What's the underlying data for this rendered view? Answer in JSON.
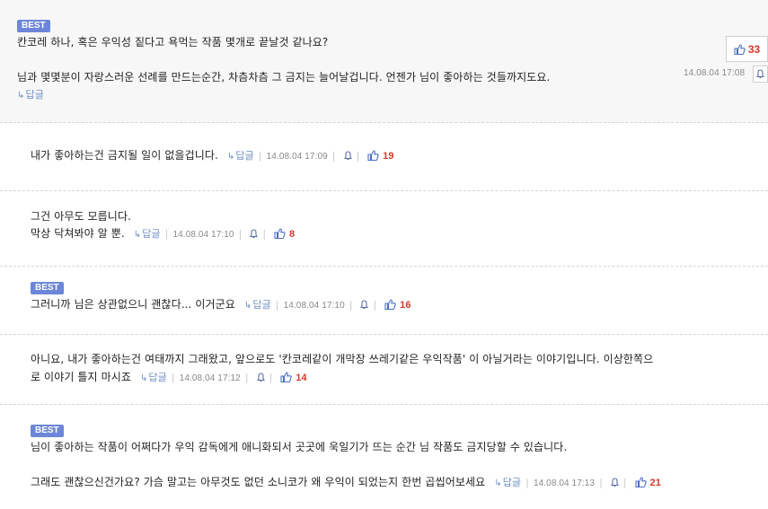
{
  "colors": {
    "badge": "#6d86d9",
    "like_count": "#d43a2c",
    "reply_link": "#6f8fc8",
    "date": "#888888"
  },
  "icons": {
    "reply": "reply-arrow-icon",
    "report": "bell-icon",
    "like": "thumbs-up-icon"
  },
  "comments": [
    {
      "badge": "BEST",
      "line1": "칸코레 하나, 혹은 우익성 짙다고 욕먹는 작품 몇개로 끝날것 같나요?",
      "line2": "님과 몇몇분이 자랑스러운 선례를 만드는순간, 차츰차츰 그 금지는 늘어날겁니다. 언젠가 님이 좋아하는 것들까지도요.",
      "reply": "답글",
      "date": "14.08.04 17:08",
      "likes": "33"
    },
    {
      "line1": "내가 좋아하는건 금지될 일이 없을겁니다.",
      "reply": "답글",
      "date": "14.08.04 17:09",
      "likes": "19"
    },
    {
      "line1": "그건 아무도 모릅니다.",
      "line2": "막상 닥쳐봐야 알 뿐.",
      "reply": "답글",
      "date": "14.08.04 17:10",
      "likes": "8"
    },
    {
      "badge": "BEST",
      "line1": "그러니까 님은 상관없으니 괜찮다... 이거군요",
      "reply": "답글",
      "date": "14.08.04 17:10",
      "likes": "16"
    },
    {
      "line1": "아니요, 내가 좋아하는건 여태까지 그래왔고, 앞으로도 '칸코레같이 개막장 쓰레기같은 우익작품' 이 아닐거라는 이야기입니다. 이상한쪽으",
      "line2": "로 이야기 틀지 마시죠",
      "reply": "답글",
      "date": "14.08.04 17:12",
      "likes": "14"
    },
    {
      "badge": "BEST",
      "line1": "님이 좋아하는 작품이 어쩌다가 우익 감독에게 애니화되서 곳곳에 욱일기가 뜨는 순간 님 작품도 금지당할 수 있습니다.",
      "line2": "그래도 괜찮으신건가요? 가슴 말고는 아무것도 없던 소니코가 왜 우익이 되었는지 한번 곱씹어보세요",
      "reply": "답글",
      "date": "14.08.04 17:13",
      "likes": "21"
    }
  ]
}
